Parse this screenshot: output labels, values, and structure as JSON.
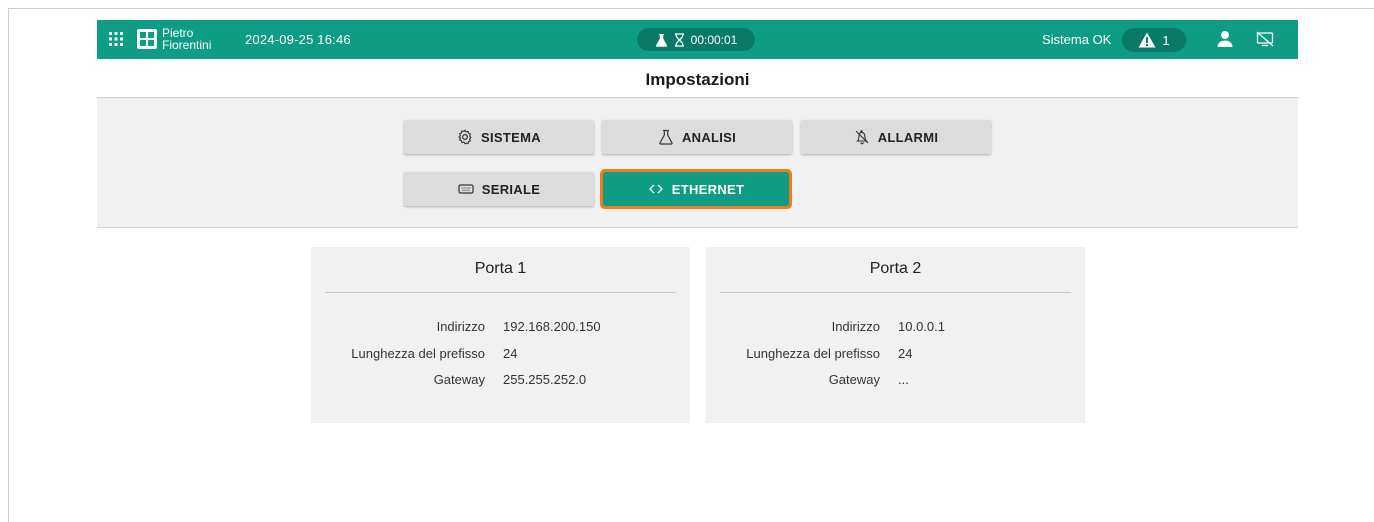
{
  "topbar": {
    "logo_line1": "Pietro",
    "logo_line2": "Fiorentini",
    "datetime": "2024-09-25 16:46",
    "timer": "00:00:01",
    "status": "Sistema OK",
    "alarm_count": "1",
    "accent_color": "#0e9c84",
    "icons": [
      "apps-grid-icon",
      "flask-icon",
      "hourglass-icon",
      "warning-icon",
      "user-icon",
      "network-disconnected-icon"
    ]
  },
  "page": {
    "title": "Impostazioni"
  },
  "tabs": [
    {
      "label": "SISTEMA",
      "icon": "gear-icon"
    },
    {
      "label": "ANALISI",
      "icon": "flask-icon"
    },
    {
      "label": "ALLARMI",
      "icon": "bell-icon"
    },
    {
      "label": "SERIALE",
      "icon": "serial-port-icon"
    },
    {
      "label": "ETHERNET",
      "icon": "code-brackets-icon",
      "active": true
    }
  ],
  "ports": [
    {
      "title": "Porta 1",
      "rows": [
        {
          "label": "Indirizzo",
          "value": "192.168.200.150"
        },
        {
          "label": "Lunghezza del prefisso",
          "value": "24"
        },
        {
          "label": "Gateway",
          "value": "255.255.252.0"
        }
      ]
    },
    {
      "title": "Porta 2",
      "rows": [
        {
          "label": "Indirizzo",
          "value": "10.0.0.1"
        },
        {
          "label": "Lunghezza del prefisso",
          "value": "24"
        },
        {
          "label": "Gateway",
          "value": "..."
        }
      ]
    }
  ]
}
